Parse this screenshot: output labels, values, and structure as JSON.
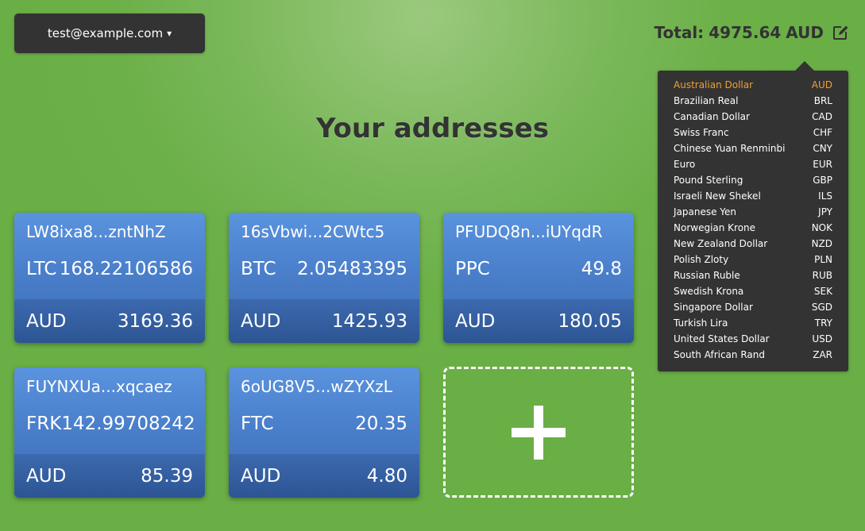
{
  "header": {
    "account_email": "test@example.com",
    "account_caret": "▾",
    "total_label": "Total:",
    "total_value": "4975.64",
    "total_currency": "AUD",
    "edit_icon": "edit-icon"
  },
  "main": {
    "title": "Your addresses"
  },
  "addresses": [
    {
      "address": "LW8ixa8...zntNhZ",
      "coin": "LTC",
      "amount": "168.22106586",
      "fiat": "AUD",
      "fiat_value": "3169.36"
    },
    {
      "address": "16sVbwi...2CWtc5",
      "coin": "BTC",
      "amount": "2.05483395",
      "fiat": "AUD",
      "fiat_value": "1425.93"
    },
    {
      "address": "PFUDQ8n...iUYqdR",
      "coin": "PPC",
      "amount": "49.8",
      "fiat": "AUD",
      "fiat_value": "180.05"
    },
    {
      "address": "FUYNXUa...xqcaez",
      "coin": "FRK",
      "amount": "142.99708242",
      "fiat": "AUD",
      "fiat_value": "85.39"
    },
    {
      "address": "6oUG8V5...wZYXzL",
      "coin": "FTC",
      "amount": "20.35",
      "fiat": "AUD",
      "fiat_value": "4.80"
    }
  ],
  "add_card": {
    "icon": "plus-icon"
  },
  "currency_menu": {
    "selected": "AUD",
    "items": [
      {
        "name": "Australian Dollar",
        "code": "AUD"
      },
      {
        "name": "Brazilian Real",
        "code": "BRL"
      },
      {
        "name": "Canadian Dollar",
        "code": "CAD"
      },
      {
        "name": "Swiss Franc",
        "code": "CHF"
      },
      {
        "name": "Chinese Yuan Renminbi",
        "code": "CNY"
      },
      {
        "name": "Euro",
        "code": "EUR"
      },
      {
        "name": "Pound Sterling",
        "code": "GBP"
      },
      {
        "name": "Israeli New Shekel",
        "code": "ILS"
      },
      {
        "name": "Japanese Yen",
        "code": "JPY"
      },
      {
        "name": "Norwegian Krone",
        "code": "NOK"
      },
      {
        "name": "New Zealand Dollar",
        "code": "NZD"
      },
      {
        "name": "Polish Zloty",
        "code": "PLN"
      },
      {
        "name": "Russian Ruble",
        "code": "RUB"
      },
      {
        "name": "Swedish Krona",
        "code": "SEK"
      },
      {
        "name": "Singapore Dollar",
        "code": "SGD"
      },
      {
        "name": "Turkish Lira",
        "code": "TRY"
      },
      {
        "name": "United States Dollar",
        "code": "USD"
      },
      {
        "name": "South African Rand",
        "code": "ZAR"
      }
    ]
  },
  "colors": {
    "background": "#6cb048",
    "dark_panel": "#333333",
    "card_blue": "#4a7fcb",
    "selected_currency": "#f0a030"
  }
}
